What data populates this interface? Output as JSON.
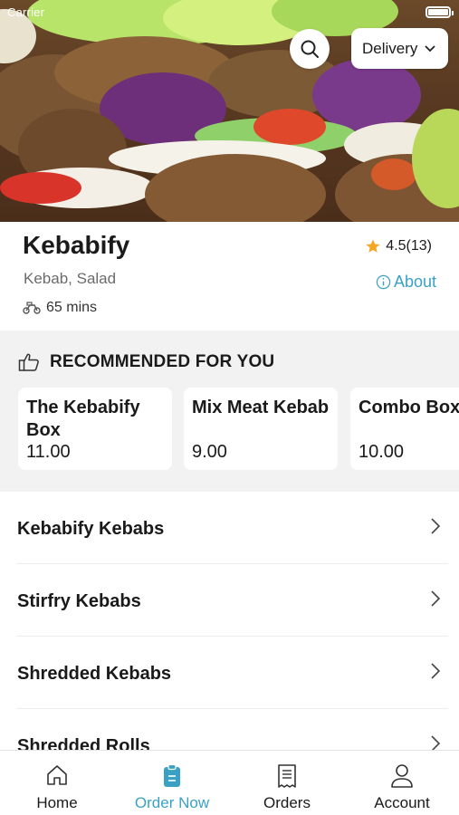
{
  "status_bar": {
    "carrier": "Carrier"
  },
  "header": {
    "delivery_mode": "Delivery"
  },
  "restaurant": {
    "name": "Kebabify",
    "cuisine": "Kebab, Salad",
    "delivery_time": "65 mins",
    "rating": "4.5(13)",
    "about_label": "About"
  },
  "recommended": {
    "heading": "RECOMMENDED FOR YOU",
    "items": [
      {
        "name": "The Kebabify Box",
        "price": "11.00"
      },
      {
        "name": "Mix Meat Kebab",
        "price": "9.00"
      },
      {
        "name": "Combo Box",
        "price": "10.00"
      }
    ]
  },
  "categories": [
    {
      "name": "Kebabify Kebabs"
    },
    {
      "name": "Stirfry Kebabs"
    },
    {
      "name": "Shredded Kebabs"
    },
    {
      "name": "Shredded Rolls"
    }
  ],
  "tabbar": {
    "items": [
      {
        "label": "Home",
        "icon": "home-icon"
      },
      {
        "label": "Order Now",
        "icon": "clipboard-icon"
      },
      {
        "label": "Orders",
        "icon": "receipt-icon"
      },
      {
        "label": "Account",
        "icon": "user-icon"
      }
    ],
    "active_index": 1
  },
  "colors": {
    "accent": "#3aa1c4",
    "star": "#f5a623",
    "section_bg": "#f2f2f2"
  }
}
